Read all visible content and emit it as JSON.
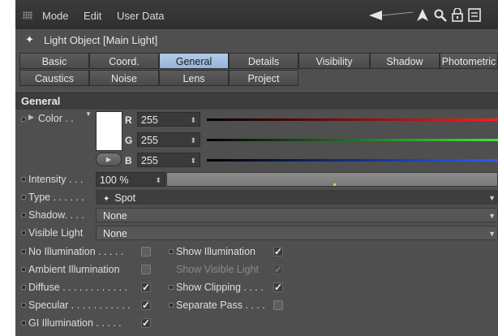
{
  "menubar": {
    "items": [
      "Mode",
      "Edit",
      "User Data"
    ],
    "icons": [
      "back-arrow-icon",
      "cursor-icon",
      "search-icon",
      "lock-icon",
      "more-icon"
    ]
  },
  "object": {
    "title": "Light Object [Main Light]"
  },
  "tabs": {
    "row1": [
      "Basic",
      "Coord.",
      "General",
      "Details",
      "Visibility",
      "Shadow",
      "Photometric"
    ],
    "row2": [
      "Caustics",
      "Noise",
      "Lens",
      "Project"
    ],
    "active": "General"
  },
  "section": {
    "title": "General"
  },
  "color": {
    "label": "Color . .",
    "swatch": "#ffffff",
    "r": {
      "letter": "R",
      "value": "255"
    },
    "g": {
      "letter": "G",
      "value": "255"
    },
    "b": {
      "letter": "B",
      "value": "255"
    }
  },
  "intensity": {
    "label": "Intensity . . .",
    "value": "100 %"
  },
  "type": {
    "label": "Type . . . . . .",
    "value": "Spot"
  },
  "shadow": {
    "label": "Shadow. . . .",
    "value": "None"
  },
  "visible_light": {
    "label": "Visible Light",
    "value": "None"
  },
  "checkboxes_left": [
    {
      "label": "No Illumination . . . . .",
      "checked": false
    },
    {
      "label": "Ambient Illumination",
      "checked": false
    },
    {
      "label": "Diffuse . . . . . . . . . . . .",
      "checked": true
    },
    {
      "label": "Specular . . . . . . . . . . .",
      "checked": true
    },
    {
      "label": "GI Illumination . . . . .",
      "checked": true
    }
  ],
  "checkboxes_right": [
    {
      "label": "Show Illumination",
      "checked": true,
      "disabled": false
    },
    {
      "label": "Show Visible Light",
      "checked": true,
      "disabled": true
    },
    {
      "label": "Show Clipping . . . .",
      "checked": true,
      "disabled": false
    },
    {
      "label": "Separate Pass . . . .",
      "checked": false,
      "disabled": false
    }
  ]
}
